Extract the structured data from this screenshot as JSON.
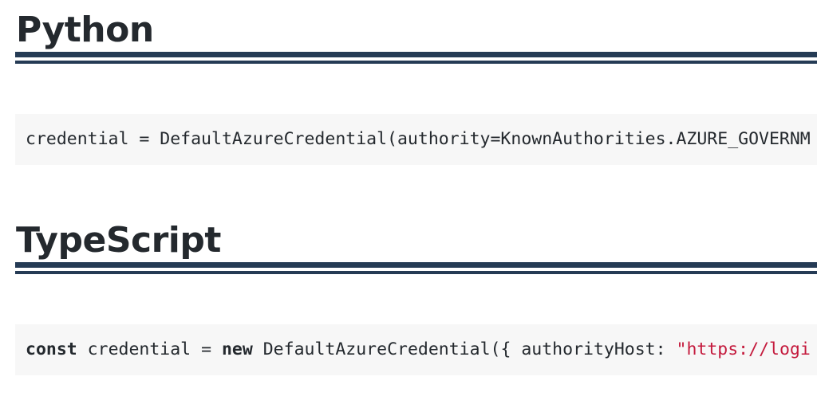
{
  "sections": [
    {
      "heading": "Python",
      "code": {
        "line": "credential = DefaultAzureCredential(authority=KnownAuthorities.AZURE_GOVERNM"
      }
    },
    {
      "heading": "TypeScript",
      "code": {
        "kw_const": "const",
        "text_1": " credential = ",
        "kw_new": "new",
        "text_2": " DefaultAzureCredential({ authorityHost: ",
        "string": "\"https://logi"
      }
    }
  ],
  "colors": {
    "heading_text": "#24292e",
    "rule": "#253b55",
    "code_background": "#f7f7f7",
    "string_literal": "#c41a3d"
  }
}
